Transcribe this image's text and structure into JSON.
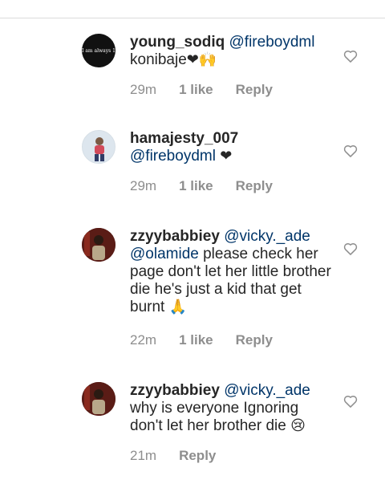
{
  "comments": [
    {
      "user": "young_sodiq",
      "mention1": "@fireboydml",
      "mention2": "",
      "text": "konibaje",
      "emoji": "❤🙌",
      "time": "29m",
      "likes": "1 like",
      "reply": "Reply",
      "avatar_text": "I am always 1"
    },
    {
      "user": "hamajesty_007",
      "mention1": "@fireboydml",
      "mention2": "",
      "text": "",
      "emoji": "❤",
      "time": "29m",
      "likes": "1 like",
      "reply": "Reply",
      "avatar_text": ""
    },
    {
      "user": "zzyybabbiey",
      "mention1": "@vicky._ade",
      "mention2": "@olamide",
      "text": "please check her page don't let her little brother die he's just a kid that get burnt",
      "emoji": "🙏",
      "time": "22m",
      "likes": "1 like",
      "reply": "Reply",
      "avatar_text": ""
    },
    {
      "user": "zzyybabbiey",
      "mention1": "@vicky._ade",
      "mention2": "",
      "text": "why is everyone Ignoring don't let her brother die",
      "emoji": "😢",
      "time": "21m",
      "likes": "",
      "reply": "Reply",
      "avatar_text": ""
    }
  ],
  "colors": {
    "username": "#262626",
    "mention": "#003569",
    "meta": "#8e8e8e",
    "divider": "#dbdbdb"
  },
  "icons": {
    "like": "heart-outline-icon"
  }
}
